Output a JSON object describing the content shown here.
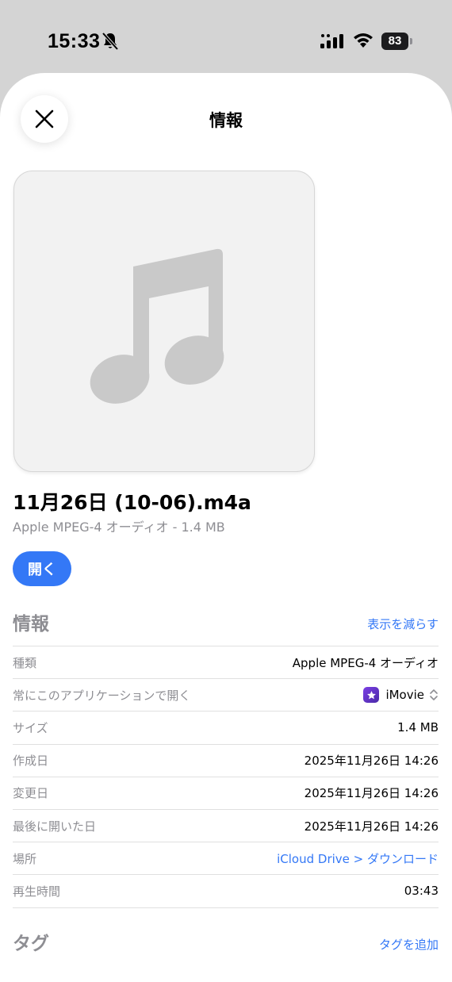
{
  "status_bar": {
    "time": "15:33",
    "battery": "83"
  },
  "sheet": {
    "title": "情報",
    "file_name": "11月26日 (10-06).m4a",
    "file_subtitle": "Apple MPEG-4 オーディオ - 1.4 MB",
    "open_label": "開く"
  },
  "info_section": {
    "heading": "情報",
    "toggle_label": "表示を減らす",
    "rows": [
      {
        "label": "種類",
        "value": "Apple MPEG-4 オーディオ"
      },
      {
        "label": "常にこのアプリケーションで開く",
        "value": "iMovie",
        "icon": "imovie-icon"
      },
      {
        "label": "サイズ",
        "value": "1.4 MB"
      },
      {
        "label": "作成日",
        "value": "2025年11月26日 14:26"
      },
      {
        "label": "変更日",
        "value": "2025年11月26日 14:26"
      },
      {
        "label": "最後に開いた日",
        "value": "2025年11月26日 14:26"
      },
      {
        "label": "場所",
        "value": "iCloud Drive > ダウンロード"
      },
      {
        "label": "再生時間",
        "value": "03:43"
      }
    ]
  },
  "tags_section": {
    "heading": "タグ",
    "add_label": "タグを追加"
  },
  "colors": {
    "accent": "#3478f6",
    "secondary_text": "#8e8e93",
    "status_bar_bg": "#d4d4d4"
  }
}
